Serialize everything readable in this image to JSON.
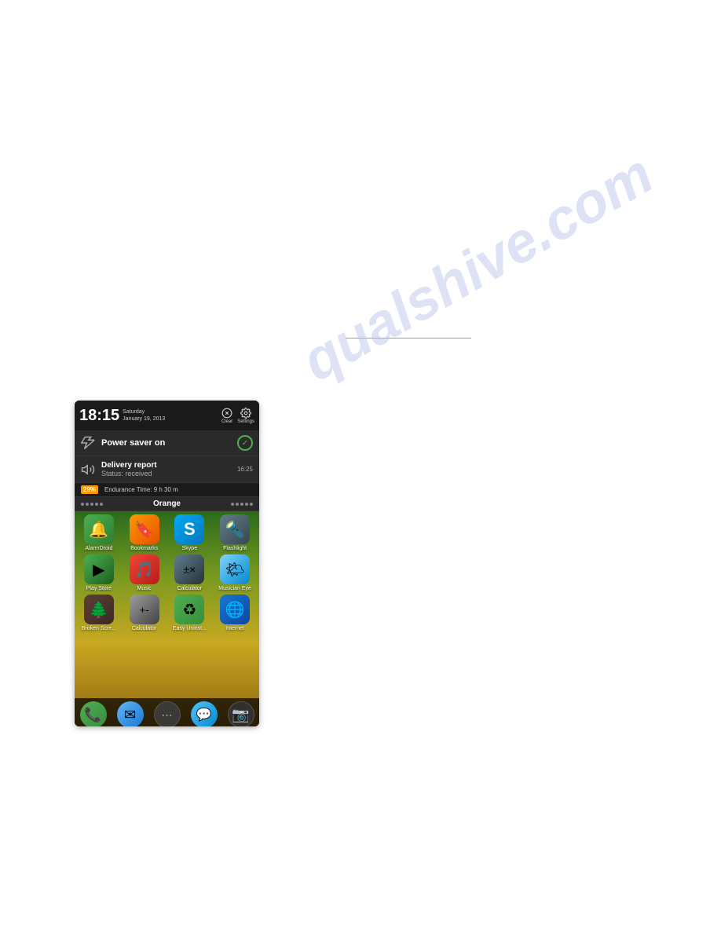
{
  "watermark": {
    "text": "qualshive.com"
  },
  "phone": {
    "status_bar": {
      "time": "18:15",
      "day": "Saturday",
      "date": "January 19, 2013",
      "clear_label": "Clear",
      "settings_label": "Settings"
    },
    "notifications": {
      "power_saver": {
        "text": "Power saver on",
        "checked": true
      },
      "delivery_report": {
        "title": "Delivery report",
        "subtitle": "Status: received",
        "time": "16:25"
      }
    },
    "battery_bar": {
      "percent": "29%",
      "endurance": "Endurance Time: 9 h 30 m"
    },
    "carrier_bar": {
      "name": "Orange"
    },
    "apps_row1": [
      {
        "label": "AlarmDroid",
        "icon": "alarm"
      },
      {
        "label": "Bookmarks",
        "icon": "bookmark"
      },
      {
        "label": "Skype",
        "icon": "skype"
      },
      {
        "label": "Flashlight",
        "icon": "flashlight"
      }
    ],
    "apps_row2": [
      {
        "label": "Play Store",
        "icon": "playstore"
      },
      {
        "label": "Music",
        "icon": "music"
      },
      {
        "label": "Calculator",
        "icon": "calculator"
      },
      {
        "label": "Musician Eye",
        "icon": "weather"
      }
    ],
    "apps_row3": [
      {
        "label": "Broken Scre...",
        "icon": "broken"
      },
      {
        "label": "Calculator",
        "icon": "calc2"
      },
      {
        "label": "Easy Uninst...",
        "icon": "easyunins"
      },
      {
        "label": "Internet",
        "icon": "internet"
      }
    ],
    "dock": [
      {
        "label": "Phone",
        "icon": "phone"
      },
      {
        "label": "Mail",
        "icon": "mail"
      },
      {
        "label": "Apps",
        "icon": "apps"
      },
      {
        "label": "Messages",
        "icon": "messages"
      },
      {
        "label": "Camera",
        "icon": "camera"
      }
    ]
  }
}
